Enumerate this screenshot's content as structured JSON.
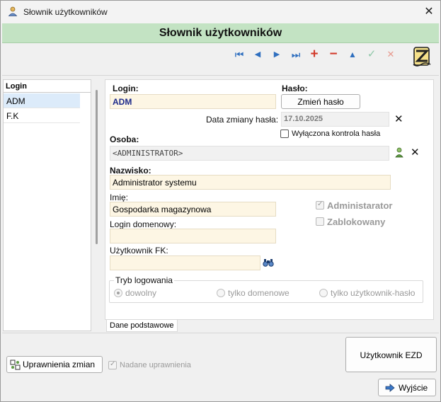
{
  "window": {
    "title": "Słownik użytkowników"
  },
  "header": {
    "title": "Słownik użytkowników"
  },
  "toolbar": {
    "buttons": [
      {
        "name": "first-record",
        "glyph": "⏮",
        "color": "#2f6fbf"
      },
      {
        "name": "prev-record",
        "glyph": "◀",
        "color": "#2f6fbf"
      },
      {
        "name": "next-record",
        "glyph": "▶",
        "color": "#2f6fbf"
      },
      {
        "name": "last-record",
        "glyph": "⏭",
        "color": "#2f6fbf"
      },
      {
        "name": "add-record",
        "glyph": "+",
        "color": "#d23a2a"
      },
      {
        "name": "delete-record",
        "glyph": "−",
        "color": "#d23a2a"
      },
      {
        "name": "edit-record",
        "glyph": "▲",
        "color": "#2f6fbf"
      },
      {
        "name": "confirm-record",
        "glyph": "✓",
        "color": "#8fc7a8"
      },
      {
        "name": "cancel-record",
        "glyph": "✕",
        "color": "#e79a8f"
      }
    ]
  },
  "list": {
    "header": "Login",
    "rows": [
      "ADM",
      "F.K"
    ]
  },
  "form": {
    "login_label": "Login:",
    "login_value": "ADM",
    "password_label": "Hasło:",
    "change_password_button": "Zmień hasło",
    "password_change_date_label": "Data zmiany hasła:",
    "password_change_date_value": "17.10.2025",
    "disable_password_check_label": "Wyłączona kontrola hasła",
    "person_label": "Osoba:",
    "person_value": "<ADMINISTRATOR>",
    "surname_label": "Nazwisko:",
    "surname_value": "Administrator systemu",
    "first_name_label": "Imię:",
    "first_name_value": "Gospodarka magazynowa",
    "domain_login_label": "Login domenowy:",
    "domain_login_value": "",
    "fk_user_label": "Użytkownik FK:",
    "fk_user_value": "",
    "administrator_label": "Administarator",
    "blocked_label": "Zablokowany",
    "login_mode": {
      "legend": "Tryb logowania",
      "options": [
        "dowolny",
        "tylko domenowe",
        "tylko użytkownik-hasło"
      ],
      "selected": "dowolny"
    },
    "tab_label": "Dane podstawowe"
  },
  "bottom": {
    "permission_changes_button": "Uprawnienia zmian",
    "granted_permissions_label": "Nadane uprawnienia",
    "ezd_user_button": "Użytkownik EZD",
    "exit_button": "Wyjście"
  }
}
